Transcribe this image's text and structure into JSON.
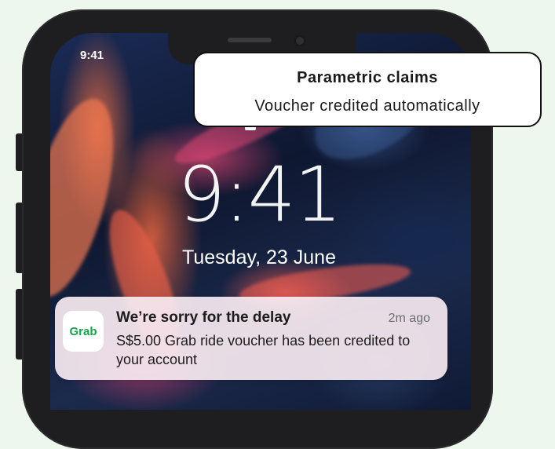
{
  "status_bar": {
    "time": "9:41"
  },
  "lock_screen": {
    "time": "9:41",
    "date": "Tuesday, 23 June"
  },
  "callout": {
    "title": "Parametric claims",
    "subtitle": "Voucher credited automatically"
  },
  "notification": {
    "app_icon_label": "Grab",
    "title": "We’re sorry for the delay",
    "time_ago": "2m ago",
    "body": "S$5.00 Grab ride voucher has been credited to your account"
  },
  "colors": {
    "background": "#eef7ee",
    "phone_frame": "#1e1e20",
    "grab_green": "#16a34a",
    "notification_bg": "#f6eaf0"
  },
  "icons": {
    "lock": "lock-icon"
  }
}
